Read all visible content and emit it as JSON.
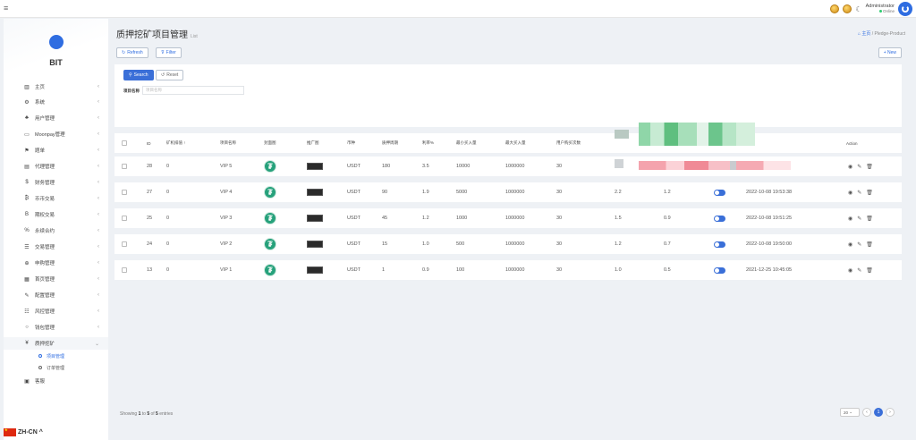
{
  "topbar": {
    "admin_name": "Administrator",
    "admin_status": "Online"
  },
  "sidebar": {
    "brand": "BIT",
    "items": [
      {
        "label": "主页",
        "icon": "chart-bar-icon"
      },
      {
        "label": "系统",
        "icon": "gear-icon"
      },
      {
        "label": "用户管理",
        "icon": "users-icon"
      },
      {
        "label": "Moonpay管理",
        "icon": "card-icon"
      },
      {
        "label": "题单",
        "icon": "flag-icon"
      },
      {
        "label": "代理管理",
        "icon": "id-card-icon"
      },
      {
        "label": "财务管理",
        "icon": "dollar-icon"
      },
      {
        "label": "币币交易",
        "icon": "bitcoin-icon"
      },
      {
        "label": "期权交易",
        "icon": "bitcoin-b-icon"
      },
      {
        "label": "永续合约",
        "icon": "percent-icon"
      },
      {
        "label": "交易管理",
        "icon": "list-icon"
      },
      {
        "label": "申购管理",
        "icon": "crosshair-icon"
      },
      {
        "label": "首页管理",
        "icon": "layout-icon"
      },
      {
        "label": "配置管理",
        "icon": "wrench-icon"
      },
      {
        "label": "风控管理",
        "icon": "shield-list-icon"
      },
      {
        "label": "钱包管理",
        "icon": "circle-icon"
      },
      {
        "label": "质押挖矿",
        "icon": "yen-icon"
      }
    ],
    "sub_items": [
      {
        "label": "项目管理"
      },
      {
        "label": "订单管理"
      }
    ],
    "last_item": {
      "label": "客服",
      "icon": "support-icon"
    },
    "language": "ZH-CN"
  },
  "main": {
    "title": "质押挖矿项目管理",
    "title_small": "List",
    "breadcrumb_home": "主页",
    "breadcrumb_sep": "/",
    "breadcrumb_current": "Pledge-Product",
    "refresh_label": "Refresh",
    "filter_label": "Filter",
    "new_label": "+ New",
    "search_label": "Search",
    "reset_label": "Reset",
    "field_label": "项目名称",
    "field_placeholder": "项目名称"
  },
  "table": {
    "headers": [
      "ID",
      "矿机排值 ↑",
      "项目名称",
      "封面图",
      "推广图",
      "币种",
      "质押周期",
      "利率%",
      "最小买入量",
      "最大买入量",
      "用户购买次数",
      "Action"
    ],
    "rows": [
      {
        "id": "28",
        "sort": "0",
        "name": "VIP 5",
        "coin": "USDT",
        "period": "180",
        "rate": "3.5",
        "min": "10000",
        "max": "1000000",
        "times": "30",
        "a": "",
        "b": "",
        "date": ""
      },
      {
        "id": "27",
        "sort": "0",
        "name": "VIP 4",
        "coin": "USDT",
        "period": "90",
        "rate": "1.9",
        "min": "5000",
        "max": "1000000",
        "times": "30",
        "a": "2.2",
        "b": "1.2",
        "date": "2022-10-08 19:53:38"
      },
      {
        "id": "25",
        "sort": "0",
        "name": "VIP 3",
        "coin": "USDT",
        "period": "45",
        "rate": "1.2",
        "min": "1000",
        "max": "1000000",
        "times": "30",
        "a": "1.5",
        "b": "0.9",
        "date": "2022-10-08 19:51:25"
      },
      {
        "id": "24",
        "sort": "0",
        "name": "VIP 2",
        "coin": "USDT",
        "period": "15",
        "rate": "1.0",
        "min": "500",
        "max": "1000000",
        "times": "30",
        "a": "1.2",
        "b": "0.7",
        "date": "2022-10-08 19:50:00"
      },
      {
        "id": "13",
        "sort": "0",
        "name": "VIP 1",
        "coin": "USDT",
        "period": "1",
        "rate": "0.9",
        "min": "100",
        "max": "1000000",
        "times": "30",
        "a": "1.0",
        "b": "0.5",
        "date": "2021-12-25 10:45:05"
      }
    ],
    "footer_prefix": "Showing",
    "footer_from": "1",
    "footer_to_word": "to",
    "footer_to": "5",
    "footer_of_word": "of",
    "footer_total": "5",
    "footer_suffix": "entries",
    "page_size": "20",
    "current_page": "1"
  },
  "colors": {
    "accent": "#3a6fd8",
    "usdt": "#26a17b"
  }
}
